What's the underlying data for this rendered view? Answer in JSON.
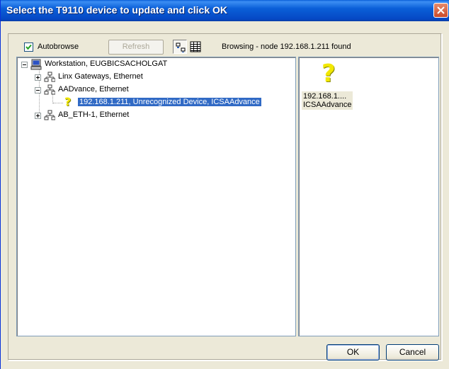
{
  "window": {
    "title": "Select the T9110 device to update and click OK"
  },
  "toolbar": {
    "autobrowse_label": "Autobrowse",
    "autobrowse_checked": true,
    "refresh_label": "Refresh",
    "status_text": "Browsing - node 192.168.1.211 found",
    "view_icons": [
      "large-icons-view-icon",
      "details-view-icon"
    ]
  },
  "tree": {
    "nodes": [
      {
        "label": "Workstation, EUGBICSACHOLGAT",
        "icon": "workstation-icon",
        "expanded": true
      },
      {
        "label": "Linx Gateways, Ethernet",
        "icon": "network-icon",
        "expanded": false
      },
      {
        "label": "AADvance, Ethernet",
        "icon": "network-icon",
        "expanded": true
      },
      {
        "label": "192.168.1.211, Unrecognized Device, ICSAAdvance",
        "icon": "unknown-device-icon",
        "selected": true
      },
      {
        "label": "AB_ETH-1, Ethernet",
        "icon": "network-icon",
        "expanded": false
      }
    ]
  },
  "detail": {
    "items": [
      {
        "line1": "192.168.1....",
        "line2": "ICSAAdvance",
        "icon": "unknown-device-icon"
      }
    ]
  },
  "buttons": {
    "ok_label": "OK",
    "cancel_label": "Cancel"
  },
  "colors": {
    "titlebar": "#0a5fd8",
    "selection": "#316ac5",
    "dialog_bg": "#ece9d8",
    "question_mark": "#f2e800"
  }
}
